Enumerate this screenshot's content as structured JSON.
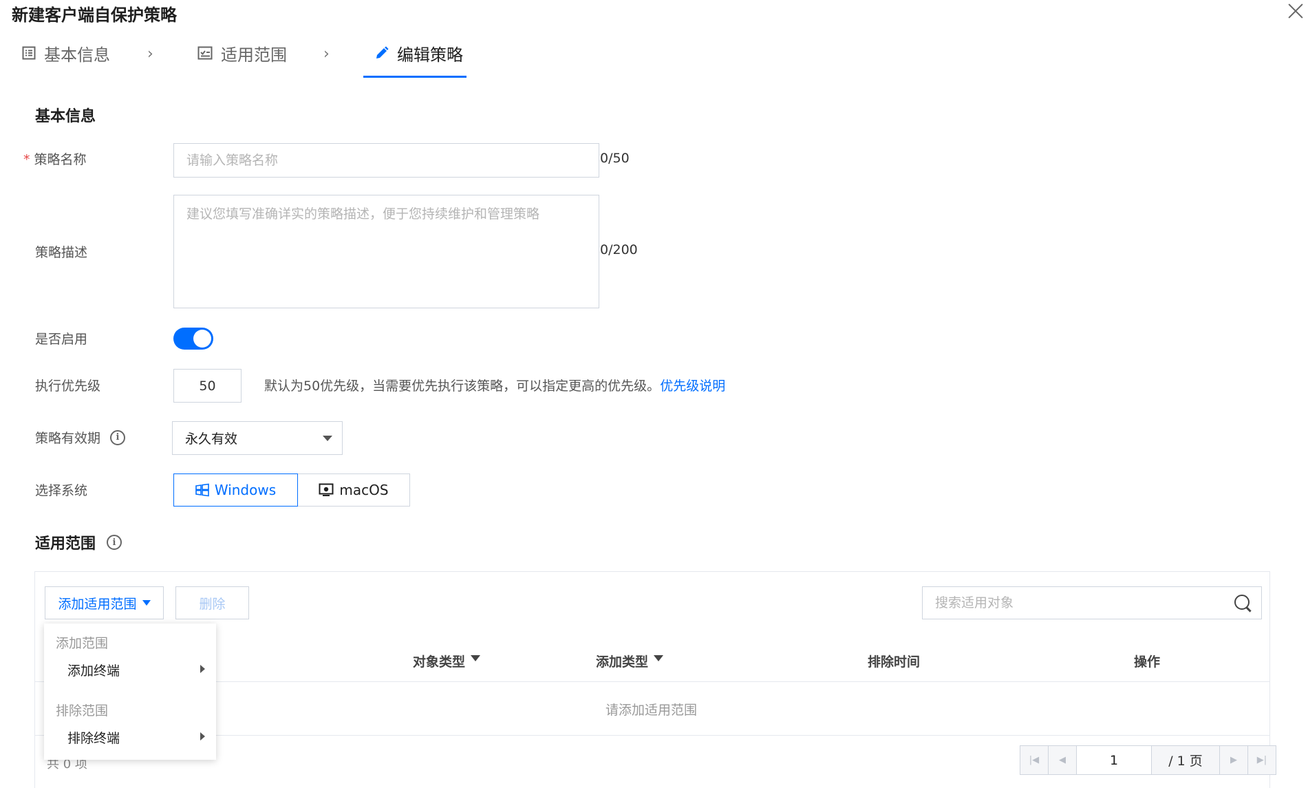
{
  "dialog": {
    "title": "新建客户端自保护策略"
  },
  "steps": [
    {
      "label": "基本信息",
      "icon": "list-icon"
    },
    {
      "label": "适用范围",
      "icon": "checklist-icon"
    },
    {
      "label": "编辑策略",
      "icon": "pencil-icon"
    }
  ],
  "basic": {
    "section_title": "基本信息",
    "name_label": "策略名称",
    "name_placeholder": "请输入策略名称",
    "name_counter": "0/50",
    "desc_label": "策略描述",
    "desc_placeholder": "建议您填写准确详实的策略描述，便于您持续维护和管理策略",
    "desc_counter": "0/200",
    "enable_label": "是否启用",
    "enabled": true,
    "priority_label": "执行优先级",
    "priority_value": "50",
    "priority_hint": "默认为50优先级，当需要优先执行该策略，可以指定更高的优先级。",
    "priority_link": "优先级说明",
    "validity_label": "策略有效期",
    "validity_value": "永久有效",
    "system_label": "选择系统",
    "system_options": [
      "Windows",
      "macOS"
    ],
    "system_selected": "Windows"
  },
  "scope": {
    "section_title": "适用范围",
    "add_button": "添加适用范围",
    "delete_button": "删除",
    "search_placeholder": "搜索适用对象",
    "columns": [
      "对象类型",
      "添加类型",
      "排除时间",
      "操作"
    ],
    "empty_text": "请添加适用范围",
    "total_text": "共 0 项",
    "pager": {
      "current": "1",
      "total": "/ 1 页"
    },
    "dropdown": {
      "group_add": "添加范围",
      "item_add": "添加终端",
      "group_exclude": "排除范围",
      "item_exclude": "排除终端"
    }
  },
  "colors": {
    "primary": "#006eff",
    "required": "#e54545"
  }
}
